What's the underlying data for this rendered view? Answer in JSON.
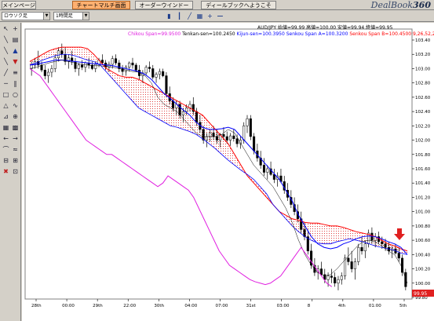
{
  "tabs": [
    {
      "label": "メインページ",
      "active": false
    },
    {
      "label": "チャートマルチ画面",
      "active": true
    },
    {
      "label": "オーダーウインドー",
      "active": false
    },
    {
      "label": "ディールブックへようこそ",
      "active": false
    }
  ],
  "brand": {
    "name": "DealBook",
    "version": "360"
  },
  "toolbar": {
    "layout_combo": "ロウソク足",
    "period_combo": "1時間足",
    "icons": [
      "bar-chart-icon",
      "candlestick-icon",
      "line-chart-icon",
      "grid-icon",
      "zoom-in-icon",
      "zoom-out-icon"
    ]
  },
  "palette_icons": [
    "pointer-icon",
    "crosshair-icon",
    "draw-line-icon",
    "trend-line-icon",
    "arrow-up-icon",
    "horizontal-line-icon",
    "vertical-line-icon",
    "ray-icon",
    "channel-icon",
    "fib-icon",
    "text-icon",
    "rectangle-icon",
    "ellipse-icon",
    "triangle-icon",
    "pen-icon",
    "label-icon",
    "delete-icon"
  ],
  "chart_data": {
    "type": "candlestick",
    "symbol": "AUD/JPY",
    "header_line": "AUD/JPY 始値=99.99 高値=100.00 安値=99.94 終値=99.95",
    "indicator_line": [
      {
        "text": "Chikou Span=99.9500",
        "color": "#e020e0"
      },
      {
        "text": "Tenkan-sen=100.2450",
        "color": "#000000"
      },
      {
        "text": "Kijun-sen=100.3950",
        "color": "#0000ff"
      },
      {
        "text": "Senkou Span A=100.3200",
        "color": "#0000ff"
      },
      {
        "text": "Senkou Span B=100.4500",
        "color": "#ff0000"
      },
      {
        "text": "9,26,52,26.0",
        "color": "#ff0000"
      }
    ],
    "x_tick_labels": [
      "28th",
      "00:00",
      "29th",
      "22:00",
      "30th",
      "04:00",
      "07:00",
      "31st",
      "03:00",
      "8",
      "4th",
      "01:00",
      "5th"
    ],
    "y_tick_labels": [
      "103.40",
      "103.20",
      "103.00",
      "102.80",
      "102.60",
      "102.40",
      "102.20",
      "102.00",
      "101.80",
      "101.60",
      "101.40",
      "101.20",
      "101.00",
      "100.80",
      "100.60",
      "100.40",
      "100.20",
      "100.00",
      "99.80"
    ],
    "y_range": [
      99.8,
      103.4
    ],
    "last_price_label": "99.95",
    "series": [
      {
        "name": "Chikou Span",
        "color": "#e020e0"
      },
      {
        "name": "Tenkan-sen",
        "color": "#000000"
      },
      {
        "name": "Kijun-sen",
        "color": "#0000ff"
      },
      {
        "name": "Senkou Span A",
        "color": "#0000ff"
      },
      {
        "name": "Senkou Span B",
        "color": "#ff0000"
      }
    ],
    "candles": [
      [
        103.0,
        103.1,
        102.9,
        103.05
      ],
      [
        103.05,
        103.15,
        103.0,
        103.1
      ],
      [
        103.1,
        103.25,
        103.0,
        103.05
      ],
      [
        103.05,
        103.1,
        102.95,
        102.98
      ],
      [
        102.98,
        103.05,
        102.85,
        102.9
      ],
      [
        102.9,
        103.0,
        102.8,
        102.95
      ],
      [
        102.95,
        103.05,
        102.88,
        103.0
      ],
      [
        103.0,
        103.2,
        102.95,
        103.15
      ],
      [
        103.15,
        103.3,
        103.1,
        103.25
      ],
      [
        103.25,
        103.35,
        103.15,
        103.2
      ],
      [
        103.2,
        103.3,
        103.05,
        103.1
      ],
      [
        103.1,
        103.2,
        103.0,
        103.15
      ],
      [
        103.15,
        103.25,
        103.05,
        103.1
      ],
      [
        103.1,
        103.15,
        102.95,
        103.0
      ],
      [
        103.0,
        103.08,
        102.9,
        103.05
      ],
      [
        103.05,
        103.12,
        102.98,
        103.02
      ],
      [
        103.02,
        103.1,
        102.95,
        103.08
      ],
      [
        103.08,
        103.15,
        103.0,
        103.05
      ],
      [
        103.05,
        103.1,
        102.98,
        103.0
      ],
      [
        103.0,
        103.1,
        102.95,
        103.06
      ],
      [
        103.06,
        103.15,
        103.02,
        103.12
      ],
      [
        103.12,
        103.2,
        103.05,
        103.08
      ],
      [
        103.08,
        103.12,
        102.98,
        103.02
      ],
      [
        103.02,
        103.1,
        102.95,
        103.06
      ],
      [
        103.06,
        103.18,
        103.0,
        103.14
      ],
      [
        103.14,
        103.2,
        103.05,
        103.08
      ],
      [
        103.08,
        103.12,
        102.95,
        103.0
      ],
      [
        103.0,
        103.05,
        102.9,
        102.96
      ],
      [
        102.96,
        103.05,
        102.9,
        103.02
      ],
      [
        103.02,
        103.1,
        102.96,
        103.08
      ],
      [
        103.08,
        103.15,
        103.0,
        103.05
      ],
      [
        103.05,
        103.08,
        102.95,
        102.98
      ],
      [
        102.98,
        103.05,
        102.85,
        102.9
      ],
      [
        102.9,
        102.98,
        102.8,
        102.94
      ],
      [
        102.94,
        103.05,
        102.9,
        103.02
      ],
      [
        103.02,
        103.1,
        102.95,
        103.0
      ],
      [
        103.0,
        103.05,
        102.85,
        102.88
      ],
      [
        102.88,
        102.95,
        102.8,
        102.92
      ],
      [
        102.92,
        103.0,
        102.85,
        102.96
      ],
      [
        102.96,
        103.0,
        102.88,
        102.9
      ],
      [
        102.9,
        102.95,
        102.6,
        102.65
      ],
      [
        102.65,
        102.75,
        102.5,
        102.55
      ],
      [
        102.55,
        102.6,
        102.4,
        102.45
      ],
      [
        102.45,
        102.55,
        102.35,
        102.5
      ],
      [
        102.5,
        102.55,
        102.3,
        102.35
      ],
      [
        102.35,
        102.45,
        102.25,
        102.4
      ],
      [
        102.4,
        102.5,
        102.35,
        102.45
      ],
      [
        102.45,
        102.55,
        102.4,
        102.5
      ],
      [
        102.5,
        102.6,
        102.35,
        102.4
      ],
      [
        102.4,
        102.45,
        102.2,
        102.25
      ],
      [
        102.25,
        102.35,
        102.1,
        102.15
      ],
      [
        102.15,
        102.2,
        101.95,
        102.0
      ],
      [
        102.0,
        102.1,
        101.9,
        102.05
      ],
      [
        102.05,
        102.15,
        101.98,
        102.1
      ],
      [
        102.1,
        102.2,
        102.0,
        102.05
      ],
      [
        102.05,
        102.15,
        101.95,
        102.0
      ],
      [
        102.0,
        102.1,
        101.9,
        102.08
      ],
      [
        102.08,
        102.18,
        102.0,
        102.05
      ],
      [
        102.05,
        102.12,
        101.95,
        102.0
      ],
      [
        102.0,
        102.1,
        101.92,
        102.06
      ],
      [
        102.06,
        102.15,
        101.98,
        102.02
      ],
      [
        102.02,
        102.08,
        101.9,
        101.95
      ],
      [
        101.95,
        102.05,
        101.88,
        102.0
      ],
      [
        102.0,
        102.25,
        101.95,
        102.2
      ],
      [
        102.2,
        102.35,
        102.1,
        102.3
      ],
      [
        102.3,
        102.35,
        102.0,
        102.05
      ],
      [
        102.05,
        102.1,
        101.8,
        101.85
      ],
      [
        101.85,
        101.95,
        101.7,
        101.75
      ],
      [
        101.75,
        101.85,
        101.6,
        101.65
      ],
      [
        101.65,
        101.75,
        101.5,
        101.55
      ],
      [
        101.55,
        101.65,
        101.45,
        101.6
      ],
      [
        101.6,
        101.7,
        101.5,
        101.52
      ],
      [
        101.52,
        101.6,
        101.4,
        101.45
      ],
      [
        101.45,
        101.55,
        101.35,
        101.5
      ],
      [
        101.5,
        101.6,
        101.4,
        101.42
      ],
      [
        101.42,
        101.5,
        101.25,
        101.3
      ],
      [
        101.3,
        101.4,
        101.15,
        101.2
      ],
      [
        101.2,
        101.3,
        101.05,
        101.1
      ],
      [
        101.1,
        101.2,
        100.95,
        101.0
      ],
      [
        101.0,
        101.1,
        100.85,
        100.9
      ],
      [
        100.9,
        101.0,
        100.7,
        100.75
      ],
      [
        100.75,
        100.85,
        100.6,
        100.65
      ],
      [
        100.65,
        100.75,
        100.4,
        100.45
      ],
      [
        100.45,
        100.55,
        100.2,
        100.25
      ],
      [
        100.25,
        100.35,
        100.1,
        100.15
      ],
      [
        100.15,
        100.25,
        100.05,
        100.2
      ],
      [
        100.2,
        100.3,
        100.1,
        100.12
      ],
      [
        100.12,
        100.2,
        100.0,
        100.05
      ],
      [
        100.05,
        100.15,
        99.95,
        100.1
      ],
      [
        100.1,
        100.2,
        100.0,
        100.08
      ],
      [
        100.08,
        100.15,
        99.95,
        100.0
      ],
      [
        100.0,
        100.1,
        99.9,
        100.05
      ],
      [
        100.05,
        100.15,
        99.98,
        100.1
      ],
      [
        100.1,
        100.4,
        100.05,
        100.35
      ],
      [
        100.35,
        100.5,
        100.25,
        100.3
      ],
      [
        100.3,
        100.45,
        100.15,
        100.2
      ],
      [
        100.2,
        100.35,
        100.05,
        100.3
      ],
      [
        100.3,
        100.55,
        100.25,
        100.5
      ],
      [
        100.5,
        100.65,
        100.4,
        100.45
      ],
      [
        100.45,
        100.6,
        100.35,
        100.55
      ],
      [
        100.55,
        100.75,
        100.5,
        100.7
      ],
      [
        100.7,
        100.78,
        100.55,
        100.6
      ],
      [
        100.6,
        100.7,
        100.5,
        100.65
      ],
      [
        100.65,
        100.72,
        100.55,
        100.58
      ],
      [
        100.58,
        100.65,
        100.48,
        100.55
      ],
      [
        100.55,
        100.62,
        100.45,
        100.5
      ],
      [
        100.5,
        100.58,
        100.4,
        100.45
      ],
      [
        100.45,
        100.52,
        100.35,
        100.48
      ],
      [
        100.48,
        100.55,
        100.4,
        100.42
      ],
      [
        100.42,
        100.5,
        100.3,
        100.35
      ],
      [
        100.35,
        100.4,
        100.1,
        100.15
      ],
      [
        100.15,
        100.2,
        99.9,
        99.95
      ]
    ],
    "tenkan_sen": [
      103.0,
      103.02,
      103.05,
      103.08,
      103.1,
      103.12,
      103.1,
      103.08,
      103.06,
      103.05,
      103.04,
      103.04,
      103.03,
      103.02,
      103.0,
      102.98,
      102.96,
      102.95,
      102.9,
      102.8,
      102.6,
      102.5,
      102.45,
      102.4,
      102.3,
      102.2,
      102.1,
      102.05,
      102.05,
      102.05,
      102.08,
      102.15,
      102.1,
      101.95,
      101.8,
      101.65,
      101.55,
      101.45,
      101.35,
      101.2,
      101.05,
      100.85,
      100.6,
      100.4,
      100.25,
      100.15,
      100.1,
      100.12,
      100.2,
      100.3,
      100.4,
      100.5,
      100.58,
      100.6,
      100.58,
      100.52,
      100.45,
      100.4,
      100.25,
      100.0
    ],
    "kijun_sen": [
      103.05,
      103.06,
      103.08,
      103.1,
      103.12,
      103.12,
      103.11,
      103.1,
      103.09,
      103.08,
      103.07,
      103.06,
      103.05,
      103.04,
      103.02,
      103.0,
      102.98,
      102.96,
      102.92,
      102.85,
      102.75,
      102.65,
      102.58,
      102.5,
      102.42,
      102.35,
      102.25,
      102.18,
      102.15,
      102.15,
      102.16,
      102.18,
      102.15,
      102.05,
      101.95,
      101.85,
      101.75,
      101.65,
      101.55,
      101.45,
      101.3,
      101.15,
      100.95,
      100.8,
      100.65,
      100.55,
      100.5,
      100.48,
      100.5,
      100.55,
      100.58,
      100.62,
      100.65,
      100.66,
      100.65,
      100.62,
      100.58,
      100.55,
      100.5,
      100.4
    ],
    "senkou_span_a": [
      103.05,
      103.08,
      103.12,
      103.15,
      103.18,
      103.2,
      103.2,
      103.18,
      103.15,
      103.12,
      103.1,
      103.05,
      102.95,
      102.85,
      102.75,
      102.65,
      102.55,
      102.45,
      102.4,
      102.35,
      102.3,
      102.25,
      102.2,
      102.18,
      102.15,
      102.12,
      102.08,
      102.02,
      101.95,
      101.88,
      101.8,
      101.72,
      101.65,
      101.58,
      101.52,
      101.45,
      101.35,
      101.25,
      101.1,
      101.0,
      100.9,
      100.8,
      100.72,
      100.65,
      100.6,
      100.56,
      100.55,
      100.55,
      100.58,
      100.6,
      100.62,
      100.6,
      100.58,
      100.55,
      100.52,
      100.5,
      100.48,
      100.46,
      100.42,
      100.4
    ],
    "senkou_span_b": [
      103.1,
      103.15,
      103.2,
      103.25,
      103.28,
      103.3,
      103.3,
      103.3,
      103.3,
      103.28,
      103.2,
      103.1,
      103.0,
      102.95,
      102.9,
      102.88,
      102.88,
      102.85,
      102.8,
      102.75,
      102.7,
      102.65,
      102.6,
      102.55,
      102.5,
      102.45,
      102.4,
      102.35,
      102.25,
      102.15,
      102.05,
      101.95,
      101.8,
      101.65,
      101.5,
      101.4,
      101.3,
      101.2,
      101.1,
      101.0,
      100.95,
      100.9,
      100.88,
      100.85,
      100.84,
      100.84,
      100.82,
      100.8,
      100.8,
      100.78,
      100.75,
      100.72,
      100.7,
      100.68,
      100.65,
      100.6,
      100.55,
      100.52,
      100.48,
      100.45
    ],
    "chikou_span": [
      103.0,
      102.95,
      102.9,
      102.8,
      102.7,
      102.6,
      102.5,
      102.4,
      102.3,
      102.2,
      102.1,
      102.0,
      101.95,
      101.9,
      101.85,
      101.8,
      101.8,
      101.75,
      101.7,
      101.65,
      101.6,
      101.55,
      101.5,
      101.45,
      101.4,
      101.35,
      101.4,
      101.5,
      101.45,
      101.4,
      101.35,
      101.3,
      101.2,
      101.05,
      100.9,
      100.75,
      100.6,
      100.45,
      100.35,
      100.25,
      100.2,
      100.15,
      100.1,
      100.05,
      100.02,
      100.0,
      99.98,
      100.0,
      100.05,
      100.1,
      100.2,
      100.3,
      100.4,
      100.5,
      100.4,
      100.3,
      100.2,
      100.1,
      100.0,
      99.95
    ]
  }
}
